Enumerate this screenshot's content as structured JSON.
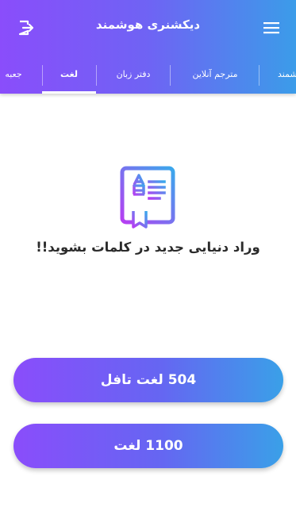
{
  "app": {
    "title": "دیکشنری هوشمند",
    "menu_icon": "hamburger-menu-icon",
    "exit_icon": "exit-to-app-icon"
  },
  "tabs": [
    {
      "label": "شمند"
    },
    {
      "label": "مترجم آنلاین"
    },
    {
      "label": "دفتر زبان"
    },
    {
      "label": "لغت",
      "selected": true
    },
    {
      "label": "جعبه"
    }
  ],
  "main": {
    "illustration_icon": "vocabulary-book-icon",
    "tagline": "وراد دنیایی جدید در کلمات بشوید!!",
    "buttons": [
      {
        "label": "504 لغت تافل"
      },
      {
        "label": "1100 لغت"
      }
    ]
  },
  "colors": {
    "gradient_start": "#8a4dfb",
    "gradient_end": "#3b9ce9",
    "text_dark": "#2b2b2b"
  }
}
